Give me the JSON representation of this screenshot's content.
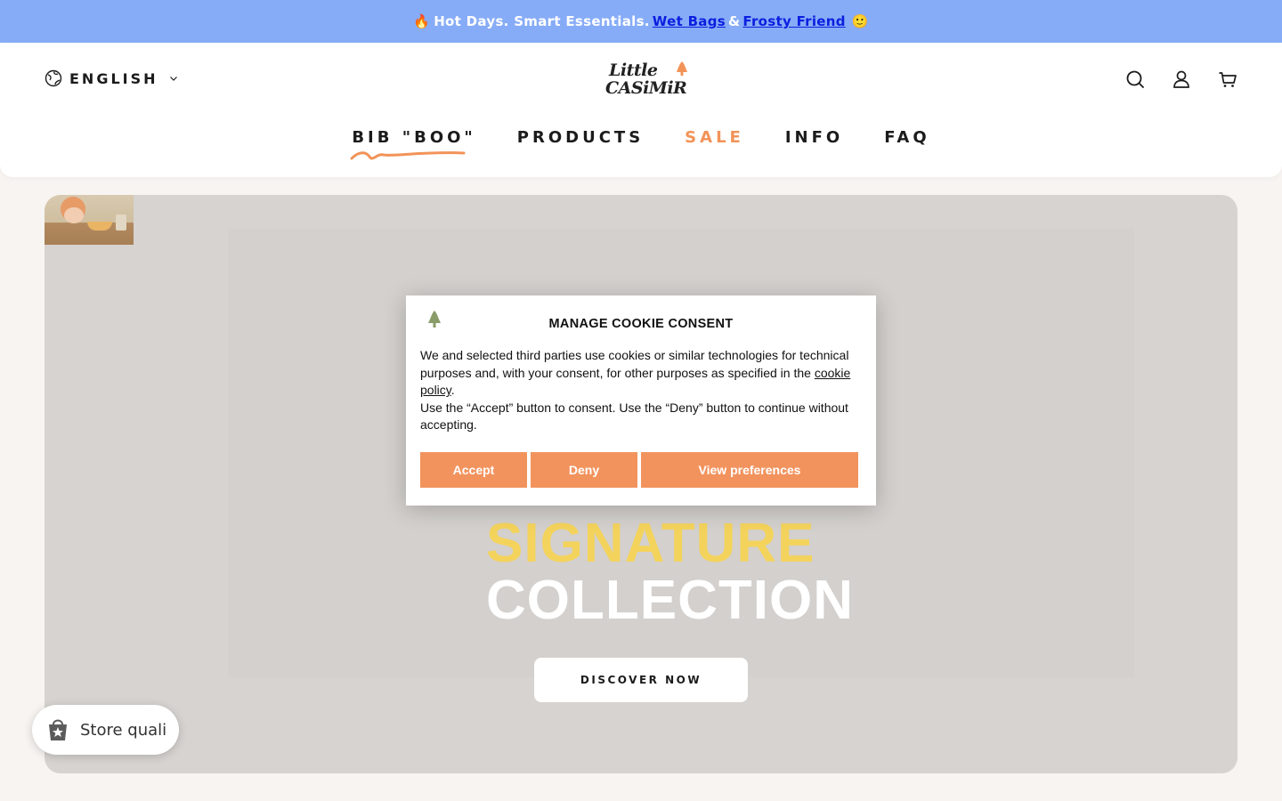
{
  "announcement": {
    "prefix": "Hot Days. Smart Essentials.",
    "link1": "Wet Bags",
    "amp": "&",
    "link2": "Frosty Friend",
    "fire_emoji": "🔥",
    "smile_emoji": "🙂"
  },
  "header": {
    "language": "ENGLISH",
    "logo_line1": "Little",
    "logo_line2": "CASiMiR",
    "icons": [
      "search-icon",
      "account-icon",
      "cart-icon"
    ]
  },
  "nav": {
    "items": [
      {
        "label": "BIB \"BOO\""
      },
      {
        "label": "PRODUCTS"
      },
      {
        "label": "SALE"
      },
      {
        "label": "INFO"
      },
      {
        "label": "FAQ"
      }
    ]
  },
  "hero": {
    "title_line1": "SIGNATURE",
    "title_line2": "COLLECTION",
    "cta": "DISCOVER NOW"
  },
  "store_widget": {
    "label": "Store quali"
  },
  "cookie": {
    "title": "MANAGE COOKIE CONSENT",
    "body_part1": "We and selected third parties use cookies or similar technologies for technical purposes and, with your consent, for other purposes as specified in the",
    "policy_link": "cookie policy",
    "body_part2": ".",
    "body_part3": "Use the “Accept” button to consent. Use the “Deny” button to continue without accepting.",
    "accept": "Accept",
    "deny": "Deny",
    "preferences": "View preferences"
  },
  "colors": {
    "announcement_bg": "#87acf7",
    "accent": "#f29358",
    "hero_yellow": "#f4d35c",
    "hero_bg": "#d6d3d0"
  }
}
